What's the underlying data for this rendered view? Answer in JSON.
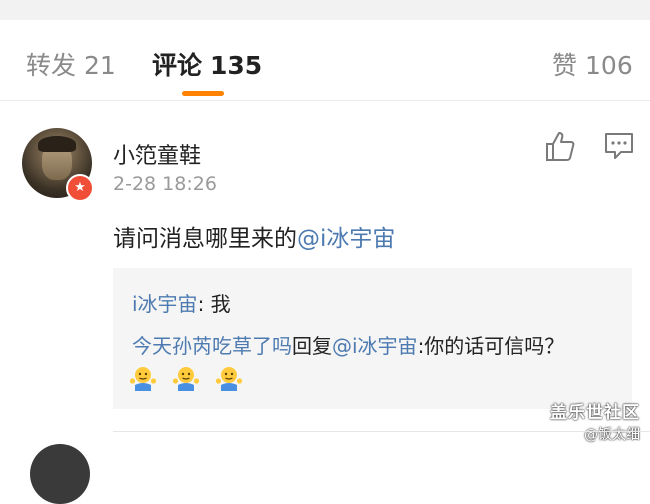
{
  "tabs": {
    "repost": {
      "label": "转发",
      "count": "21"
    },
    "comments": {
      "label": "评论",
      "count": "135"
    },
    "likes": {
      "label": "赞",
      "count": "106"
    },
    "active_color": "#ff8200"
  },
  "comment": {
    "username": "小笵童鞋",
    "timestamp": "2-28 18:26",
    "text": "请问消息哪里来的",
    "mention": "@i冰宇宙",
    "icons": {
      "like": "thumbs-up-icon",
      "reply": "comment-bubble-icon",
      "badge": "verified-badge-icon"
    }
  },
  "replies": [
    {
      "author": "i冰宇宙",
      "text": ": 我"
    },
    {
      "author": "今天孙芮吃草了吗",
      "verb": "回复",
      "mention": "@i冰宇宙",
      "text": ":你的话可信吗？",
      "emoji": [
        "shrug-emoji",
        "shrug-emoji",
        "shrug-emoji"
      ]
    }
  ],
  "watermark": {
    "brand": "盖乐世社区",
    "handle": "@饭太细"
  },
  "colors": {
    "link": "#4d7ab0",
    "muted": "#9a9a9a",
    "accent": "#ff8200",
    "badge": "#f04e37"
  }
}
